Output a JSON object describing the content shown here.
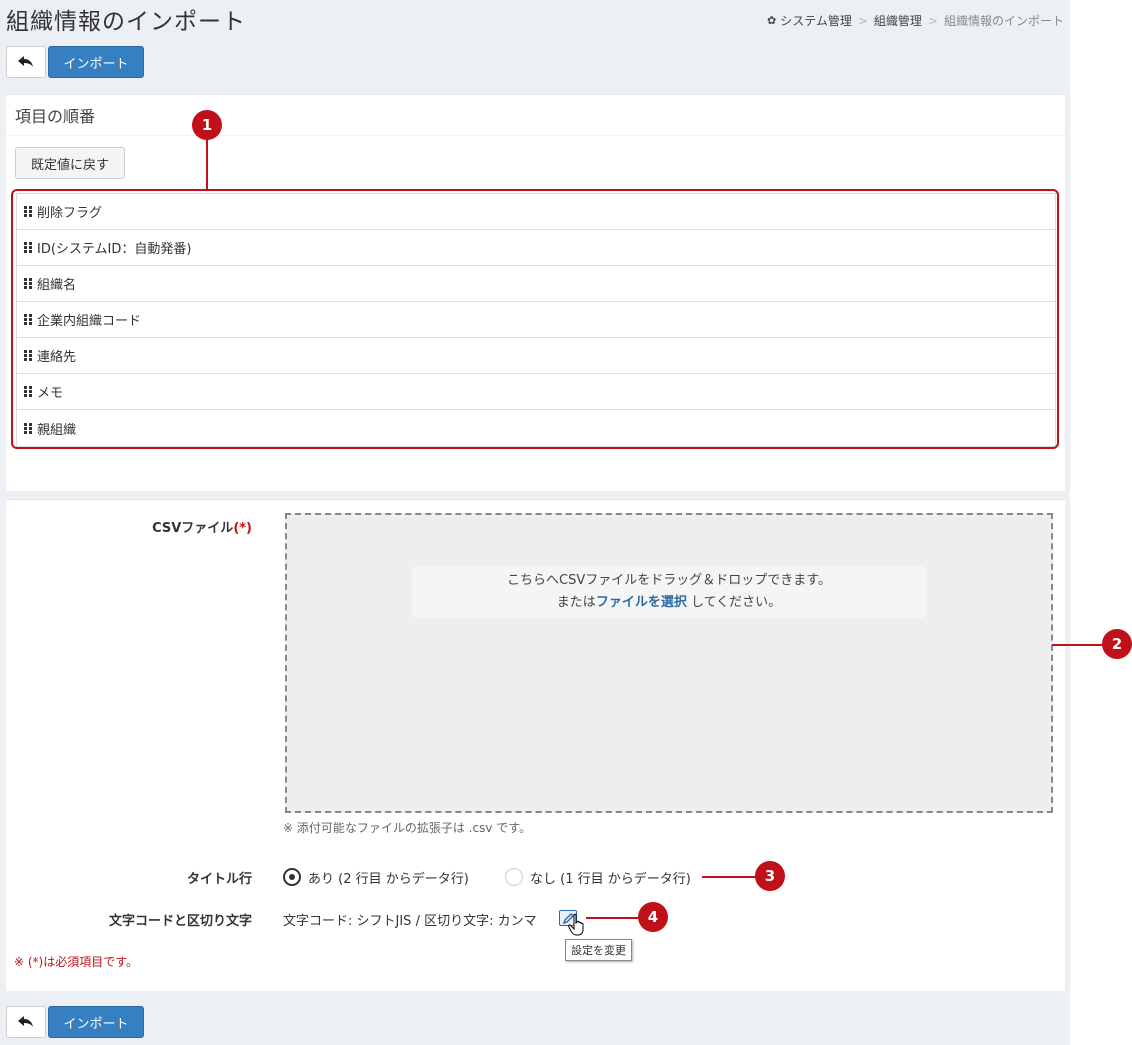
{
  "header": {
    "title": "組織情報のインポート",
    "breadcrumb": [
      "システム管理",
      "組織管理",
      "組織情報のインポート"
    ],
    "breadcrumb_sep": ">"
  },
  "toolbar": {
    "import_label": "インポート"
  },
  "order_section": {
    "title": "項目の順番",
    "reset_label": "既定値に戻す",
    "items": [
      "削除フラグ",
      "ID(システムID：自動発番)",
      "組織名",
      "企業内組織コード",
      "連絡先",
      "メモ",
      "親組織"
    ]
  },
  "form": {
    "csv_label": "CSVファイル",
    "required_mark": "(*)",
    "drop_line1": "こちらへCSVファイルをドラッグ＆ドロップできます。",
    "drop_line2_prefix": "または",
    "drop_link": "ファイルを選択",
    "drop_line2_suffix": " してください。",
    "ext_note": "※ 添付可能なファイルの拡張子は .csv です。",
    "title_row_label": "タイトル行",
    "title_row_options": [
      "あり (2 行目 からデータ行)",
      "なし (1 行目 からデータ行)"
    ],
    "title_row_selected": 0,
    "encoding_label": "文字コードと区切り文字",
    "encoding_value": "文字コード: シフトJIS / 区切り文字: カンマ",
    "edit_tooltip": "設定を変更",
    "required_note": "※ (*)は必須項目です。"
  },
  "callouts": [
    "1",
    "2",
    "3",
    "4"
  ],
  "colors": {
    "accent": "#367fc0",
    "callout": "#c0101a"
  }
}
